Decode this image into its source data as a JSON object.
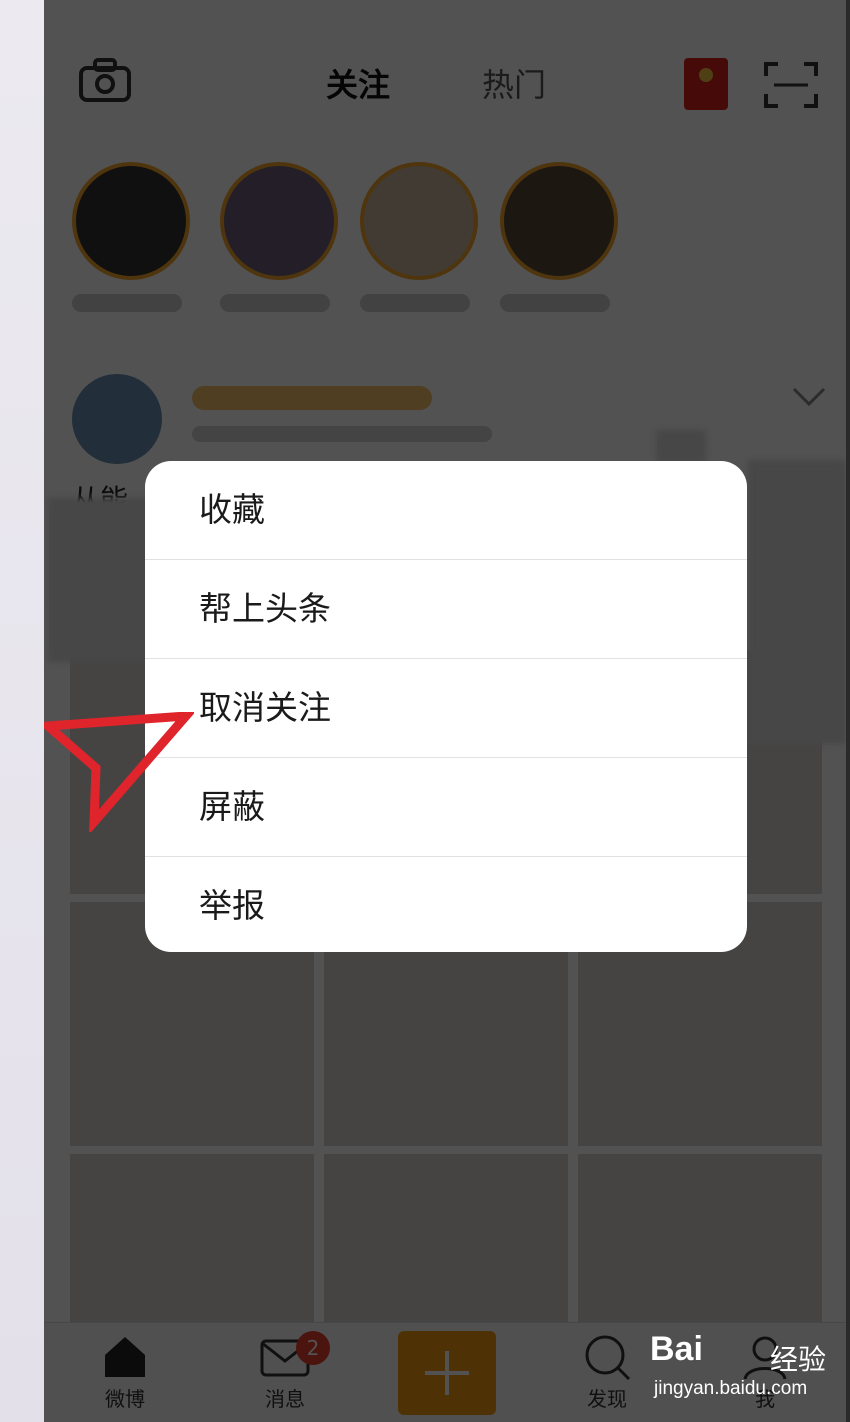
{
  "header": {
    "tabs": [
      {
        "label": "关注",
        "active": true
      },
      {
        "label": "热门",
        "active": false
      }
    ]
  },
  "context_menu": {
    "items": [
      "收藏",
      "帮上头条",
      "取消关注",
      "屏蔽",
      "举报"
    ]
  },
  "bottom_nav": {
    "items": [
      {
        "label": "微博",
        "icon": "home-icon"
      },
      {
        "label": "消息",
        "icon": "mail-icon",
        "badge": "2"
      },
      {
        "label": "",
        "icon": "plus-icon"
      },
      {
        "label": "发现",
        "icon": "search-icon"
      },
      {
        "label": "我",
        "icon": "profile-icon"
      }
    ]
  },
  "post": {
    "text_preview": "从能"
  },
  "watermark": {
    "brand": "Bai",
    "brand_cn": "经验",
    "url": "jingyan.baidu.com"
  },
  "colors": {
    "accent": "#f39c12",
    "annotation_arrow": "#e0242b",
    "badge": "#e8402d"
  }
}
